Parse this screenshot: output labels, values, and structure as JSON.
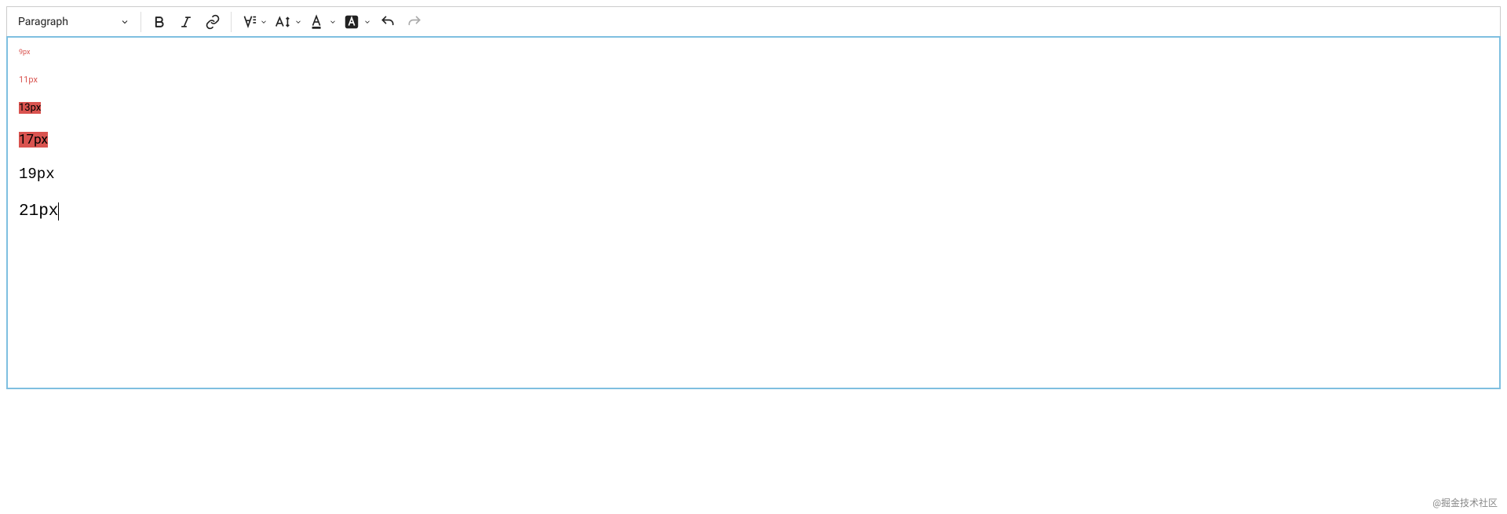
{
  "toolbar": {
    "format_selected": "Paragraph"
  },
  "content": {
    "lines": [
      {
        "text": "9px",
        "size": 9,
        "style": "red"
      },
      {
        "text": "11px",
        "size": 11,
        "style": "red"
      },
      {
        "text": "13px",
        "size": 13,
        "style": "redbg"
      },
      {
        "text": "17px",
        "size": 17,
        "style": "redbg"
      },
      {
        "text": "19px",
        "size": 19,
        "style": "mono"
      },
      {
        "text": "21px",
        "size": 21,
        "style": "mono",
        "caret": true
      }
    ]
  },
  "watermark": "@掘金技术社区"
}
